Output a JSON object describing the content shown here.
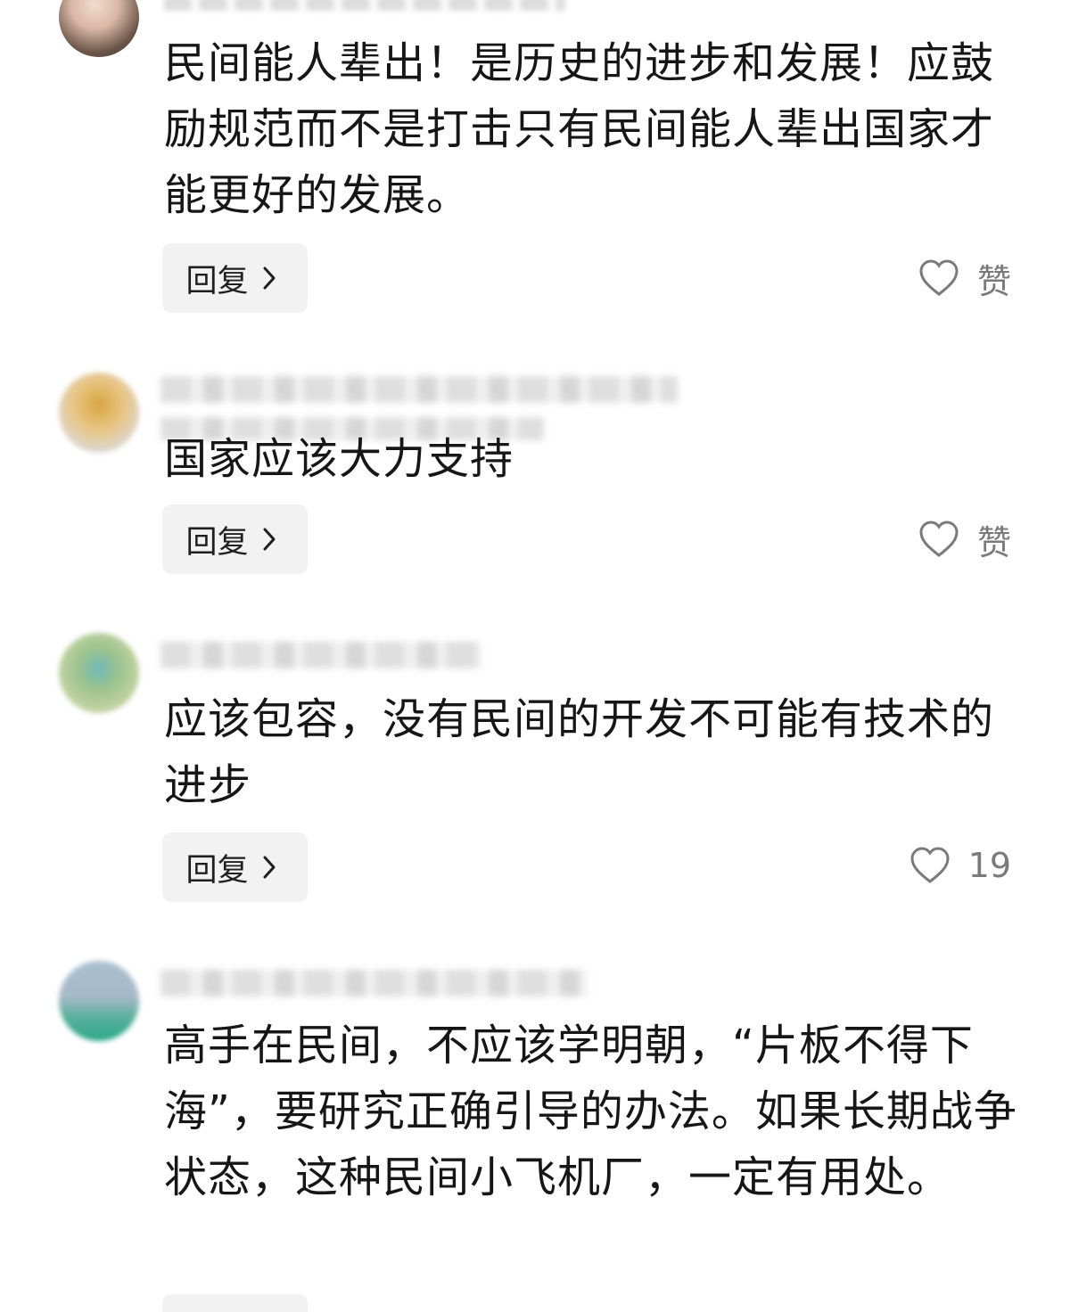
{
  "comments": [
    {
      "text": "民间能人辈出！是历史的进步和发展！应鼓励规范而不是打击只有民间能人辈出国家才能更好的发展。",
      "reply_label": "回复",
      "like_label": "赞"
    },
    {
      "text": "国家应该大力支持",
      "reply_label": "回复",
      "like_label": "赞"
    },
    {
      "text": "应该包容，没有民间的开发不可能有技术的进步",
      "reply_label": "回复",
      "like_label": "19"
    },
    {
      "text": "高手在民间，不应该学明朝，“片板不得下海”，要研究正确引导的办法。如果长期战争状态，这种民间小飞机厂，一定有用处。"
    }
  ],
  "icons": {
    "reply_chevron": "chevron-right-icon",
    "like": "heart-outline-icon"
  },
  "colors": {
    "text": "#161616",
    "reply_bg": "#f2f2f2",
    "like_gray": "#7a7a7a"
  }
}
